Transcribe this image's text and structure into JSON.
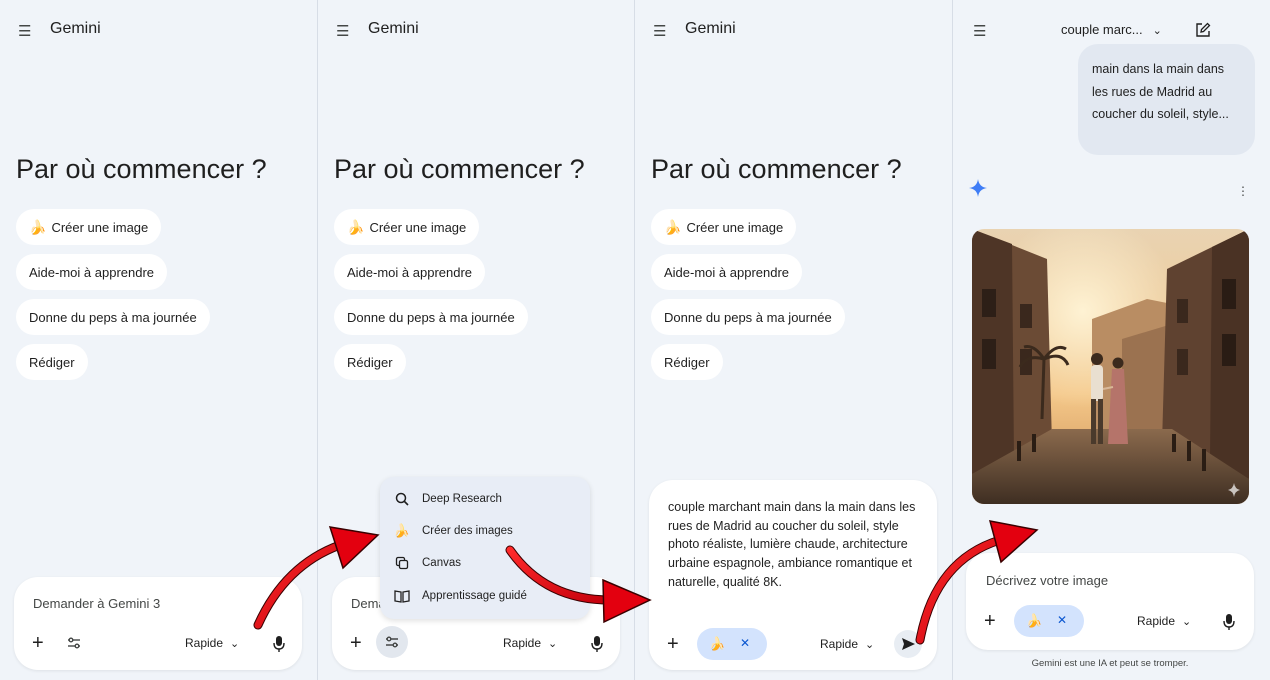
{
  "panels": [
    {
      "app_title": "Gemini",
      "heading": "Par où commencer ?",
      "chips": [
        "Créer une image",
        "Aide-moi à apprendre",
        "Donne du peps à ma journée",
        "Rédiger"
      ],
      "input_placeholder": "Demander à Gemini 3",
      "model_label": "Rapide"
    },
    {
      "app_title": "Gemini",
      "heading": "Par où commencer ?",
      "chips": [
        "Créer une image",
        "Aide-moi à apprendre",
        "Donne du peps à ma journée",
        "Rédiger"
      ],
      "input_placeholder": "Dema",
      "model_label": "Rapide",
      "tools_menu": [
        "Deep Research",
        "Créer des images",
        "Canvas",
        "Apprentissage guidé"
      ]
    },
    {
      "app_title": "Gemini",
      "heading": "Par où commencer ?",
      "chips": [
        "Créer une image",
        "Aide-moi à apprendre",
        "Donne du peps à ma journée",
        "Rédiger"
      ],
      "prompt_text": "couple marchant main dans la main dans les rues de Madrid au coucher du soleil, style photo réaliste, lumière chaude, architecture urbaine espagnole, ambiance romantique et naturelle, qualité 8K.",
      "model_label": "Rapide"
    },
    {
      "conversation_title": "couple marc...",
      "user_message_visible": "main dans la main dans les rues de Madrid au coucher du soleil, style...",
      "input_placeholder": "Décrivez votre image",
      "model_label": "Rapide",
      "disclaimer": "Gemini est une IA et peut se tromper."
    }
  ],
  "colors": {
    "background": "#f0f4f9",
    "surface": "#ffffff",
    "accent_blue": "#0b57d0",
    "pill_blue": "#d3e3fd",
    "arrow_red": "#e3000f"
  },
  "icons": {
    "menu": "hamburger-icon",
    "banana": "banana-icon",
    "tools": "tools-sliders-icon",
    "mic": "mic-icon",
    "send": "send-icon",
    "edit": "new-chat-icon",
    "gemini": "gemini-spark-icon"
  }
}
